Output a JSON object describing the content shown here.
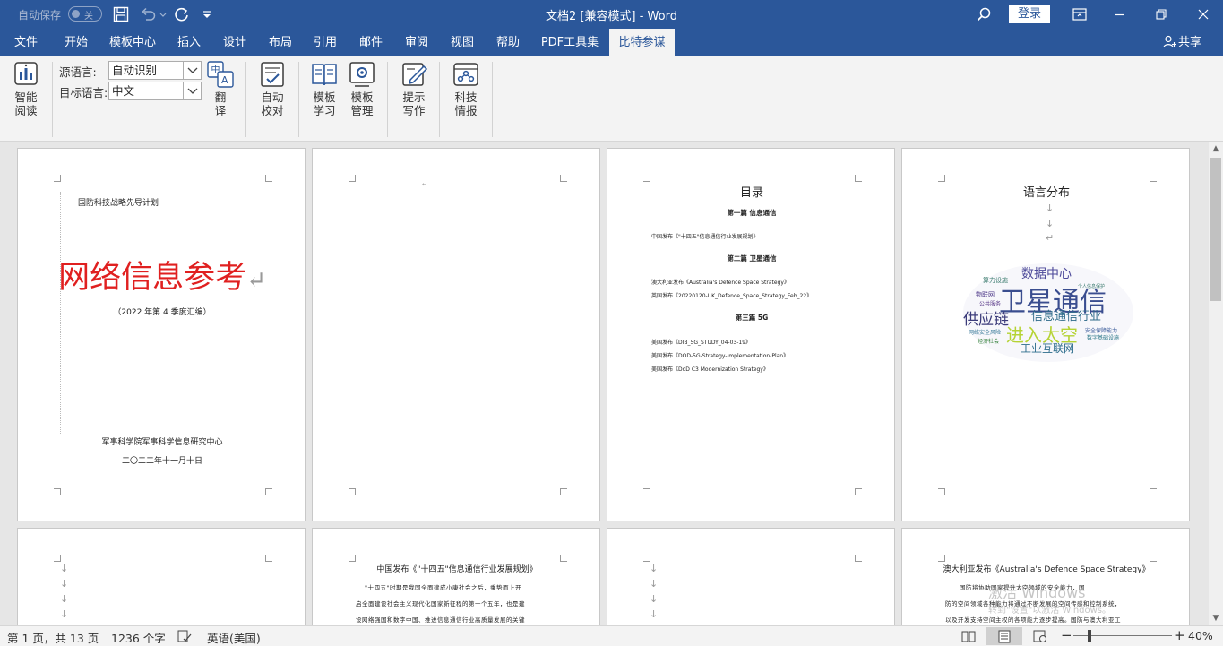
{
  "titlebar": {
    "autosave_label": "自动保存",
    "autosave_state": "关",
    "doc_title": "文档2 [兼容模式] - Word",
    "login_label": "登录"
  },
  "menu": {
    "tabs": [
      "文件",
      "开始",
      "模板中心",
      "插入",
      "设计",
      "布局",
      "引用",
      "邮件",
      "审阅",
      "视图",
      "帮助",
      "PDF工具集",
      "比特参谋"
    ],
    "active_tab": "比特参谋",
    "share_label": "共享"
  },
  "ribbon": {
    "smart_read": [
      "智能",
      "阅读"
    ],
    "source_lang_label": "源语言:",
    "source_lang_value": "自动识别",
    "target_lang_label": "目标语言:",
    "target_lang_value": "中文",
    "translate": [
      "翻",
      "译"
    ],
    "auto_proof": [
      "自动",
      "校对"
    ],
    "template_learn": [
      "模板",
      "学习"
    ],
    "template_manage": [
      "模板",
      "管理"
    ],
    "hint_write": [
      "提示",
      "写作"
    ],
    "tech_intel": [
      "科技",
      "情报"
    ]
  },
  "pages": {
    "p1": {
      "header": "国防科技战略先导计划",
      "title": "网络信息参考",
      "subtitle": "（2022 年第 4 季度汇编）",
      "org": "军事科学院军事科学信息研究中心",
      "date": "二〇二二年十一月十日"
    },
    "p3": {
      "title": "目录",
      "sec1": "第一篇  信息通信",
      "sec1_items": [
        "中国发布《\"十四五\"信息通信行业发展规划》"
      ],
      "sec2": "第二篇  卫星通信",
      "sec2_items": [
        "澳大利亚发布《Australia's Defence Space Strategy》",
        "英国发布《20220120-UK_Defence_Space_Strategy_Feb_22》"
      ],
      "sec3": "第三篇  5G",
      "sec3_items": [
        "美国发布《DIB_5G_STUDY_04-03-19》",
        "美国发布《DOD-5G-Strategy-Implementation-Plan》",
        "美国发布《DoD C3 Modernization Strategy》"
      ]
    },
    "p4": {
      "title": "语言分布",
      "words": [
        "卫星通信",
        "数据中心",
        "供应链",
        "信息通信行业",
        "进入太空",
        "工业互联网",
        "算力设施",
        "物联网",
        "网络安全风险",
        "经济社会",
        "安全保障能力",
        "数字基础设施",
        "公共服务",
        "个人信息保护"
      ]
    },
    "p6": {
      "title": "中国发布《\"十四五\"信息通信行业发展规划》",
      "lines": [
        "\"十四五\"时期是我国全面建成小康社会之后，乘势而上开",
        "启全面建设社会主义现代化国家新征程的第一个五年，也是建",
        "设网络强国和数字中国、推进信息通信行业高质量发展的关键"
      ]
    },
    "p8": {
      "title": "澳大利亚发布《Australia's Defence Space Strategy》",
      "lines": [
        "国防将协助国家提升太空领域的安全能力，国",
        "防的空间领域各种能力将通过不断发展的空间传感和控制系统，",
        "以及开发支持空间主权的各项能力逐步提高。国防与澳大利亚工"
      ]
    }
  },
  "watermark": {
    "line1": "激活 Windows",
    "line2": "转到\"设置\"以激活 Windows。"
  },
  "statusbar": {
    "page_info": "第 1 页，共 13 页",
    "word_count": "1236 个字",
    "language": "英语(美国)",
    "zoom": "40%"
  }
}
